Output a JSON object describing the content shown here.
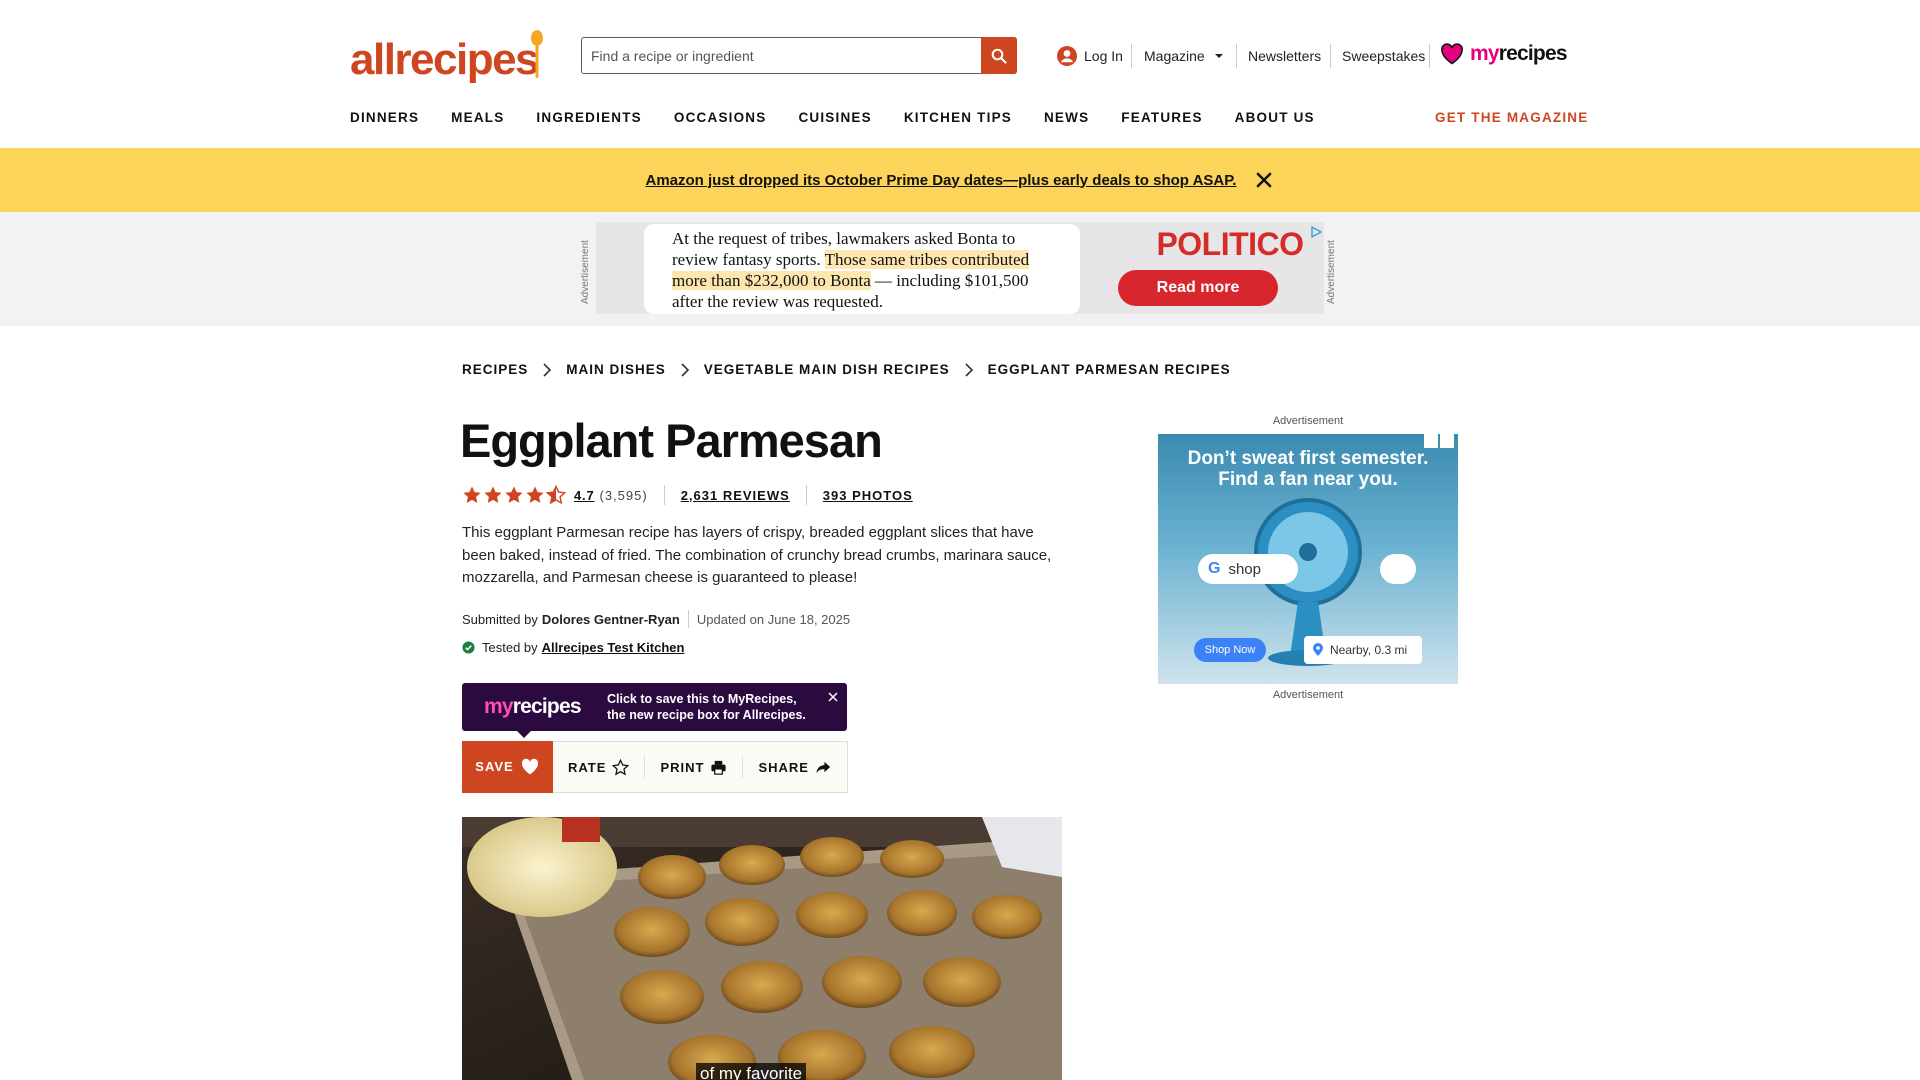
{
  "header": {
    "logo_text": "allrecipes",
    "search_placeholder": "Find a recipe or ingredient",
    "login": "Log In",
    "magazine": "Magazine",
    "newsletters": "Newsletters",
    "sweepstakes": "Sweepstakes",
    "myrecipes_my": "my",
    "myrecipes_recipes": "recipes",
    "nav": [
      "DINNERS",
      "MEALS",
      "INGREDIENTS",
      "OCCASIONS",
      "CUISINES",
      "KITCHEN TIPS",
      "NEWS",
      "FEATURES",
      "ABOUT US"
    ],
    "get_magazine": "GET THE MAGAZINE",
    "brand_color": "#ce4620"
  },
  "banner": {
    "text": "Amazon just dropped its October Prime Day dates—plus early deals to shop ASAP.",
    "bg_color": "#fcd45a"
  },
  "top_ad": {
    "label": "Advertisement",
    "line1": "At the request of tribes, lawmakers asked Bonta to",
    "line2a": "review fantasy sports. ",
    "line2b": "Those same tribes contributed",
    "line3a": "more than $232,000 to Bonta",
    "line3b": " — including $101,500",
    "line4": "after the review was requested.",
    "brand": "POLITICO",
    "cta": "Read more"
  },
  "breadcrumb": [
    "RECIPES",
    "MAIN DISHES",
    "VEGETABLE MAIN DISH RECIPES",
    "EGGPLANT PARMESAN RECIPES"
  ],
  "recipe": {
    "title": "Eggplant Parmesan",
    "rating": "4.7",
    "rating_count": "(3,595)",
    "rating_stars": 4.5,
    "reviews": "2,631 REVIEWS",
    "photos": "393 PHOTOS",
    "description": "This eggplant Parmesan recipe has layers of crispy, breaded eggplant slices that have been baked, instead of fried. The combination of crunchy bread crumbs, marinara sauce, mozzarella, and Parmesan cheese is guaranteed to please!",
    "submitted_prefix": "Submitted by",
    "author": "Dolores Gentner-Ryan",
    "updated": "Updated on June 18, 2025",
    "tested_prefix": "Tested by",
    "tested_by": "Allrecipes Test Kitchen"
  },
  "myrecipes_tip": {
    "logo_my": "my",
    "logo_recipes": "recipes",
    "line1": "Click to save this to MyRecipes,",
    "line2": "the new recipe box for Allrecipes."
  },
  "actions": {
    "save": "SAVE",
    "rate": "RATE",
    "print": "PRINT",
    "share": "SHARE"
  },
  "video": {
    "caption": "of my favorite"
  },
  "side_ad": {
    "label_top": "Advertisement",
    "label_bottom": "Advertisement",
    "headline1": "Don’t sweat first semester.",
    "headline2": "Find a fan near you.",
    "shop_word": "shop",
    "shop_now": "Shop Now",
    "nearby": "Nearby, 0.3 mi"
  }
}
